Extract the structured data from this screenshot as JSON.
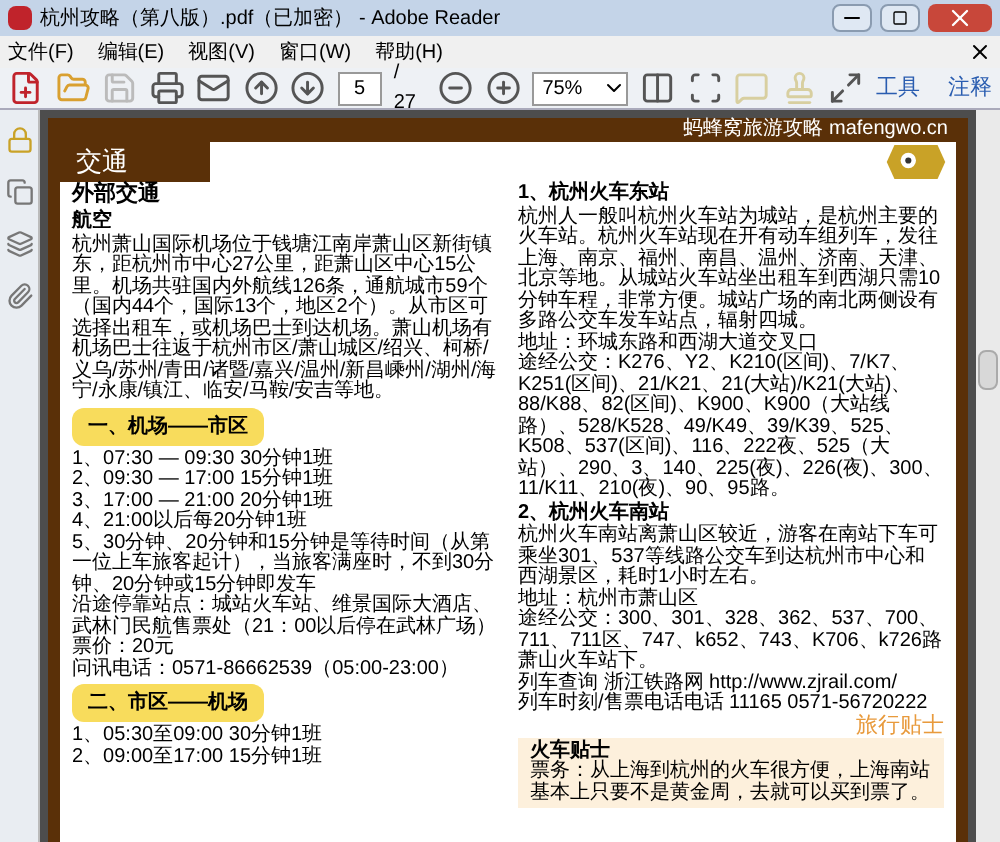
{
  "window": {
    "title": "杭州攻略（第八版）.pdf（已加密） - Adobe Reader"
  },
  "menu": [
    {
      "label": "文件(F)"
    },
    {
      "label": "编辑(E)"
    },
    {
      "label": "视图(V)"
    },
    {
      "label": "窗口(W)"
    },
    {
      "label": "帮助(H)"
    }
  ],
  "toolbar": {
    "page": "5",
    "page_count": "/ 27",
    "zoom": "75%",
    "panels": [
      {
        "label": "工具"
      },
      {
        "label": "注释"
      }
    ]
  },
  "document": {
    "brand": "蚂蜂窝旅游攻略 mafengwo.cn",
    "section": "交通",
    "left": [
      {
        "kind": "h1",
        "text": "外部交通"
      },
      {
        "kind": "h2",
        "text": "航空"
      },
      {
        "kind": "p",
        "text": "杭州萧山国际机场位于钱塘江南岸萧山区新街镇东，距杭州市中心27公里，距萧山区中心15公里。机场共驻国内外航线126条，通航城市59个（国内44个，国际13个，地区2个）。从市区可选择出租车，或机场巴士到达机场。萧山机场有机场巴士往返于杭州市区/萧山城区/绍兴、柯桥/义乌/苏州/青田/诸暨/嘉兴/温州/新昌嵊州/湖州/海宁/永康/镇江、临安/马鞍/安吉等地。"
      },
      {
        "kind": "pill",
        "text": "一、机场——市区"
      },
      {
        "kind": "li",
        "text": "1、07:30 — 09:30  30分钟1班"
      },
      {
        "kind": "li",
        "text": "2、09:30 — 17:00  15分钟1班"
      },
      {
        "kind": "li",
        "text": "3、17:00 — 21:00  20分钟1班"
      },
      {
        "kind": "li",
        "text": "4、21:00以后每20分钟1班"
      },
      {
        "kind": "li",
        "text": "5、30分钟、20分钟和15分钟是等待时间（从第一位上车旅客起计），当旅客满座时，不到30分钟、20分钟或15分钟即发车"
      },
      {
        "kind": "p",
        "text": "沿途停靠站点：城站火车站、维景国际大酒店、武林门民航售票处（21：00以后停在武林广场）"
      },
      {
        "kind": "li",
        "text": "票价：20元"
      },
      {
        "kind": "li",
        "text": "问讯电话：0571-86662539（05:00-23:00）"
      },
      {
        "kind": "pill",
        "text": "二、市区——机场"
      },
      {
        "kind": "li",
        "text": "1、05:30至09:00  30分钟1班"
      },
      {
        "kind": "li",
        "text": "2、09:00至17:00  15分钟1班"
      }
    ],
    "right": [
      {
        "kind": "h3",
        "text": "1、杭州火车东站"
      },
      {
        "kind": "p",
        "text": "杭州人一般叫杭州火车站为城站，是杭州主要的火车站。杭州火车站现在开有动车组列车，发往上海、南京、福州、南昌、温州、济南、天津、北京等地。从城站火车站坐出租车到西湖只需10分钟车程，非常方便。城站广场的南北两侧设有多路公交车发车站点，辐射四城。"
      },
      {
        "kind": "li",
        "text": "地址：环城东路和西湖大道交叉口"
      },
      {
        "kind": "p",
        "text": "途经公交：K276、Y2、K210(区间)、7/K7、K251(区间)、21/K21、21(大站)/K21(大站)、88/K88、82(区间)、K900、K900（大站线路）、528/K528、49/K49、39/K39、525、K508、537(区间)、116、222夜、525（大站）、290、3、140、225(夜)、226(夜)、300、11/K11、210(夜)、90、95路。"
      },
      {
        "kind": "h3",
        "text": "2、杭州火车南站"
      },
      {
        "kind": "p",
        "text": "杭州火车南站离萧山区较近，游客在南站下车可乘坐301、537等线路公交车到达杭州市中心和西湖景区，耗时1小时左右。"
      },
      {
        "kind": "li",
        "text": "地址：杭州市萧山区"
      },
      {
        "kind": "p",
        "text": "途经公交：300、301、328、362、537、700、711、711区、747、k652、743、K706、k726路萧山火车站下。"
      },
      {
        "kind": "li",
        "text": "列车查询 浙江铁路网 http://www.zjrail.com/"
      },
      {
        "kind": "li",
        "text": "列车时刻/售票电话电话 11165 0571-56720222"
      },
      {
        "kind": "tips",
        "text": "旅行贴士"
      },
      {
        "kind": "tipbox",
        "title": "火车贴士",
        "text": "票务：从上海到杭州的火车很方便，上海南站基本上只要不是黄金周，去就可以买到票了。"
      }
    ]
  }
}
